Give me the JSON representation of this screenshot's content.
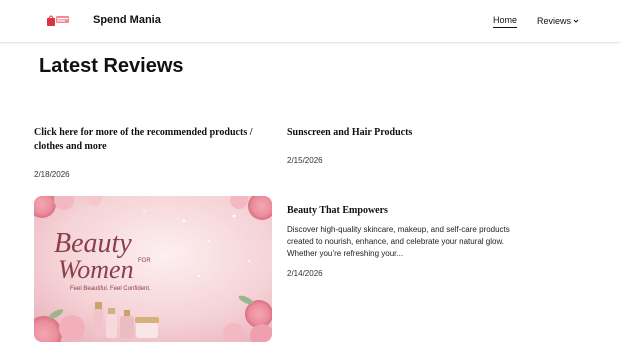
{
  "header": {
    "site_title": "Spend Mania",
    "nav": {
      "home": "Home",
      "reviews": "Reviews"
    }
  },
  "main": {
    "page_title": "Latest Reviews",
    "posts": [
      {
        "title": "Click here for more of the recommended products / clothes and more",
        "date": "2/18/2026"
      },
      {
        "title": "Sunscreen and Hair Products",
        "date": "2/15/2026"
      },
      {
        "title": "Beauty That Empowers",
        "excerpt": "Discover high-quality skincare, makeup, and self-care products created to nourish, enhance, and celebrate your natural glow. Whether you’re refreshing your...",
        "date": "2/14/2026",
        "image": {
          "headline_1": "Beauty",
          "headline_2": "FOR",
          "headline_3": "Women",
          "tagline": "Feel Beautiful. Feel Confident."
        }
      }
    ]
  },
  "colors": {
    "accent_pink": "#e8a0a8",
    "logo_red": "#d9343f",
    "image_bg": "#f7d9dc"
  },
  "icons": {
    "logo": "shopping-logo-icon",
    "reviews_dropdown": "chevron-down-icon"
  }
}
